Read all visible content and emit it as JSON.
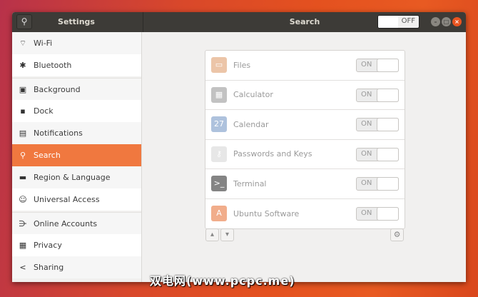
{
  "header": {
    "sidebar_title": "Settings",
    "panel_title": "Search",
    "search_toggle": {
      "label": "OFF",
      "state": "off"
    }
  },
  "sidebar": {
    "items": [
      {
        "label": "Wi-Fi",
        "icon": "wifi-icon",
        "glyph": "⌔"
      },
      {
        "label": "Bluetooth",
        "icon": "bluetooth-icon",
        "glyph": "✱"
      },
      {
        "label": "Background",
        "icon": "background-icon",
        "glyph": "▣"
      },
      {
        "label": "Dock",
        "icon": "dock-icon",
        "glyph": "▪"
      },
      {
        "label": "Notifications",
        "icon": "notifications-icon",
        "glyph": "▤"
      },
      {
        "label": "Search",
        "icon": "search-icon",
        "glyph": "⚲",
        "selected": true
      },
      {
        "label": "Region & Language",
        "icon": "region-icon",
        "glyph": "▬"
      },
      {
        "label": "Universal Access",
        "icon": "universal-access-icon",
        "glyph": "☺"
      },
      {
        "label": "Online Accounts",
        "icon": "online-accounts-icon",
        "glyph": "⋺"
      },
      {
        "label": "Privacy",
        "icon": "privacy-icon",
        "glyph": "▦"
      },
      {
        "label": "Sharing",
        "icon": "sharing-icon",
        "glyph": "<"
      }
    ]
  },
  "search_sources": [
    {
      "name": "Files",
      "toggle": "ON",
      "color": "#e0a070",
      "glyph": "▭"
    },
    {
      "name": "Calculator",
      "toggle": "ON",
      "color": "#9a9a9a",
      "glyph": "▦"
    },
    {
      "name": "Calendar",
      "toggle": "ON",
      "color": "#7a9ac8",
      "glyph": "27"
    },
    {
      "name": "Passwords and Keys",
      "toggle": "ON",
      "color": "#d8d8d8",
      "glyph": "⚷"
    },
    {
      "name": "Terminal",
      "toggle": "ON",
      "color": "#333333",
      "glyph": ">_"
    },
    {
      "name": "Ubuntu Software",
      "toggle": "ON",
      "color": "#e8773f",
      "glyph": "A"
    }
  ],
  "controls": {
    "up": "^",
    "down": "v",
    "settings": "⚙"
  },
  "watermark": "双电网(www.pcpc.me)"
}
